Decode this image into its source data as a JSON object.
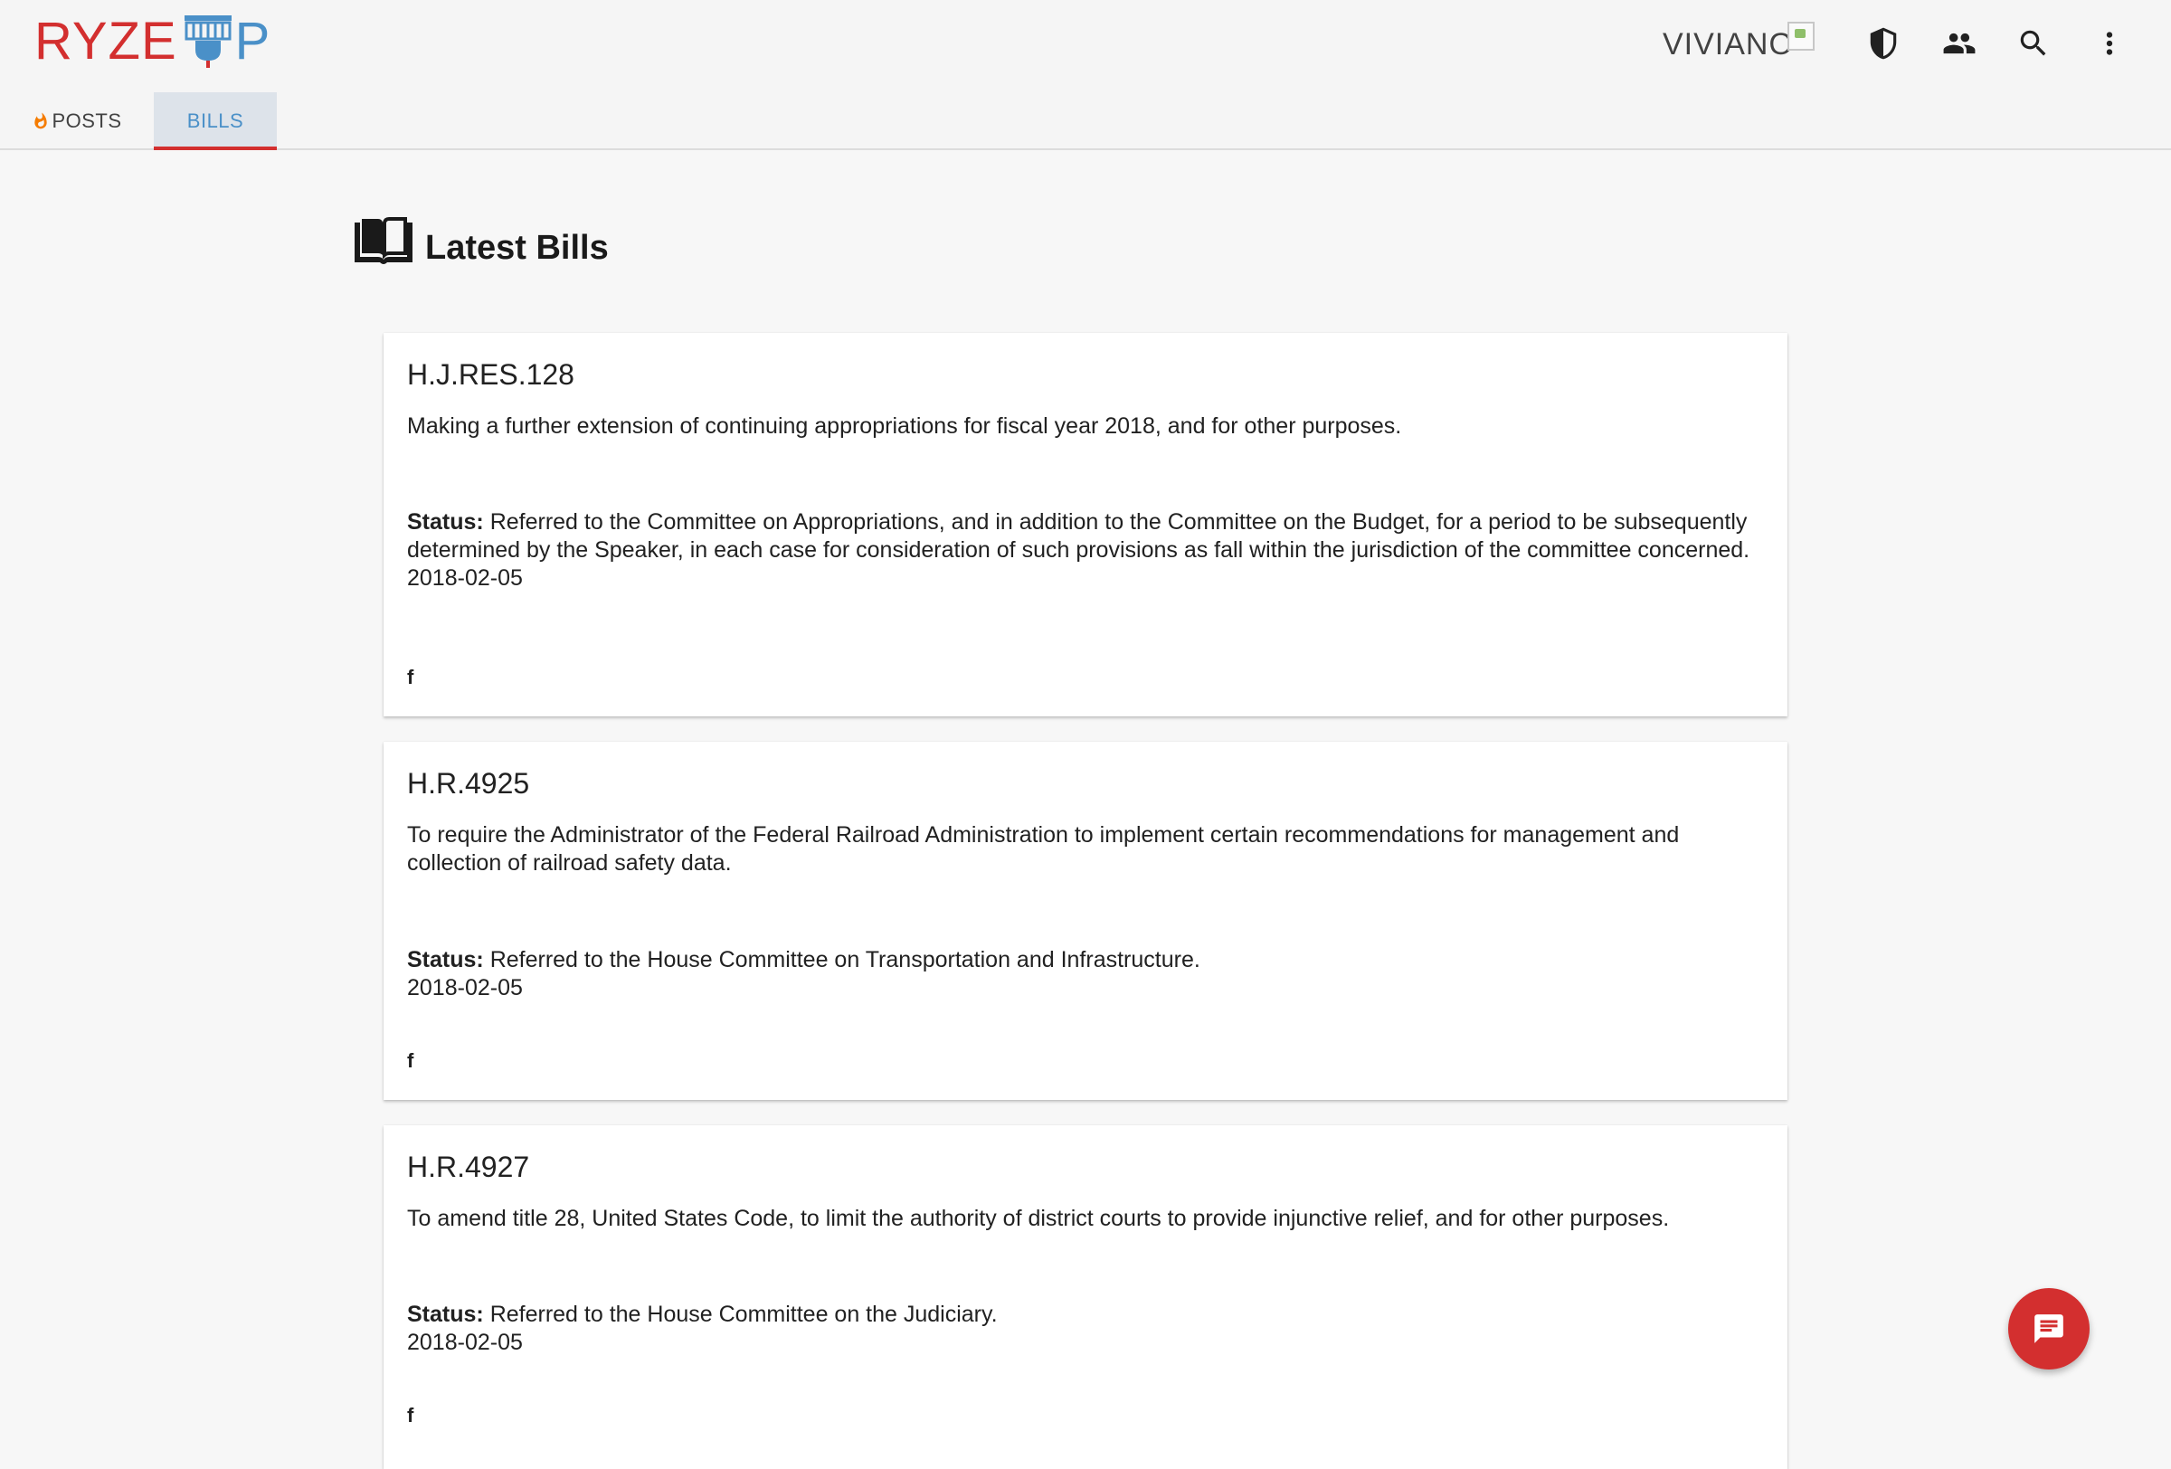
{
  "brand": {
    "name_left": "RYZE",
    "name_right": "P",
    "color_left": "#d32f2f",
    "color_right": "#4a90c8"
  },
  "header": {
    "user_name": "VIVIANO",
    "icons": [
      "shield-icon",
      "people-icon",
      "search-icon",
      "more-vert-icon"
    ]
  },
  "tabs": [
    {
      "label": "POSTS",
      "icon": "flame-icon",
      "active": false
    },
    {
      "label": "BILLS",
      "active": true
    }
  ],
  "main": {
    "title": "Latest Bills",
    "icon": "book-icon"
  },
  "bills": [
    {
      "id": "H.J.RES.128",
      "description": "Making a further extension of continuing appropriations for fiscal year 2018, and for other purposes.",
      "status_label": "Status:",
      "status": "Referred to the Committee on Appropriations, and in addition to the Committee on the Budget, for a period to be subsequently determined by the Speaker, in each case for consideration of such provisions as fall within the jurisdiction of the committee concerned.",
      "date": "2018-02-05",
      "share_icon": "facebook-icon"
    },
    {
      "id": "H.R.4925",
      "description": "To require the Administrator of the Federal Railroad Administration to implement certain recommendations for management and collection of railroad safety data.",
      "status_label": "Status:",
      "status": "Referred to the House Committee on Transportation and Infrastructure.",
      "date": "2018-02-05",
      "share_icon": "facebook-icon"
    },
    {
      "id": "H.R.4927",
      "description": "To amend title 28, United States Code, to limit the authority of district courts to provide injunctive relief, and for other purposes.",
      "status_label": "Status:",
      "status": "Referred to the House Committee on the Judiciary.",
      "date": "2018-02-05",
      "share_icon": "facebook-icon"
    }
  ],
  "fab": {
    "icon": "chat-icon"
  },
  "colors": {
    "accent": "#d32f2f",
    "tab_active_text": "#4a90c8",
    "tab_active_bg": "#dde3ea",
    "page_bg": "#f7f7f7"
  }
}
